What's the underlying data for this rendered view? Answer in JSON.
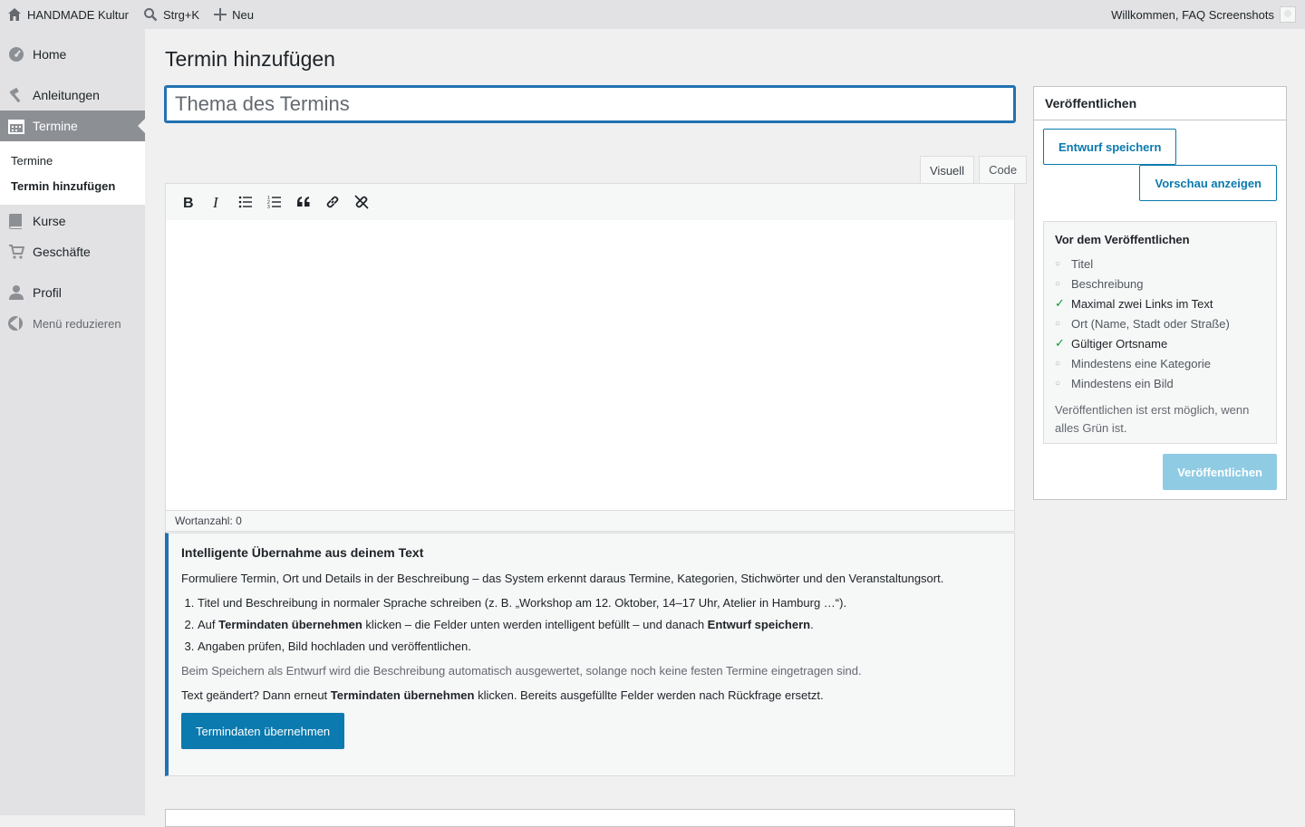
{
  "adminbar": {
    "site_name": "HANDMADE Kultur",
    "search_shortcut": "Strg+K",
    "new_label": "Neu",
    "greeting": "Willkommen, FAQ Screenshots"
  },
  "sidebar": {
    "items": [
      {
        "label": "Home",
        "icon": "dashboard-icon"
      },
      {
        "label": "Anleitungen",
        "icon": "hammer-icon"
      },
      {
        "label": "Termine",
        "icon": "calendar-icon"
      },
      {
        "label": "Kurse",
        "icon": "book-icon"
      },
      {
        "label": "Geschäfte",
        "icon": "cart-icon"
      },
      {
        "label": "Profil",
        "icon": "user-icon"
      }
    ],
    "submenu": [
      "Termine",
      "Termin hinzufügen"
    ],
    "collapse_label": "Menü reduzieren"
  },
  "page": {
    "title": "Termin hinzufügen",
    "title_placeholder": "Thema des Termins"
  },
  "editor": {
    "tab_visual": "Visuell",
    "tab_code": "Code",
    "toolbar": [
      "bold-icon",
      "italic-icon",
      "bullet-list-icon",
      "numbered-list-icon",
      "quote-icon",
      "link-icon",
      "unlink-icon"
    ],
    "wordcount": "Wortanzahl: 0"
  },
  "notice": {
    "heading": "Intelligente Übernahme aus deinem Text",
    "intro": "Formuliere Termin, Ort und Details in der Beschreibung – das System erkennt daraus Termine, Kategorien, Stichwörter und den Veranstaltungsort.",
    "step1": "Titel und Beschreibung in normaler Sprache schreiben (z. B. „Workshop am 12. Oktober, 14–17 Uhr, Atelier in Hamburg …“).",
    "step2_a": "Auf ",
    "step2_b": "Termindaten übernehmen",
    "step2_c": " klicken – die Felder unten werden intelligent befüllt – und danach ",
    "step2_d": "Entwurf speichern",
    "step2_e": ".",
    "step3": "Angaben prüfen, Bild hochladen und veröffentlichen.",
    "auto_note": "Beim Speichern als Entwurf wird die Beschreibung automatisch ausgewertet, solange noch keine festen Termine eingetragen sind.",
    "changed_a": "Text geändert? Dann erneut ",
    "changed_b": "Termindaten übernehmen",
    "changed_c": " klicken. Bereits ausgefüllte Felder werden nach Rückfrage ersetzt.",
    "button": "Termindaten übernehmen"
  },
  "publish": {
    "heading": "Veröffentlichen",
    "save_draft": "Entwurf speichern",
    "preview": "Vorschau anzeigen",
    "checklist_heading": "Vor dem Veröffentlichen",
    "checklist": [
      {
        "label": "Titel",
        "ok": false
      },
      {
        "label": "Beschreibung",
        "ok": false
      },
      {
        "label": "Maximal zwei Links im Text",
        "ok": true
      },
      {
        "label": "Ort (Name, Stadt oder Straße)",
        "ok": false
      },
      {
        "label": "Gültiger Ortsname",
        "ok": true
      },
      {
        "label": "Mindestens eine Kategorie",
        "ok": false
      },
      {
        "label": "Mindestens ein Bild",
        "ok": false
      }
    ],
    "pending_mark": "○",
    "ok_mark": "✓",
    "hint": "Veröffentlichen ist erst möglich, wenn alles Grün ist.",
    "publish_button": "Veröffentlichen"
  }
}
